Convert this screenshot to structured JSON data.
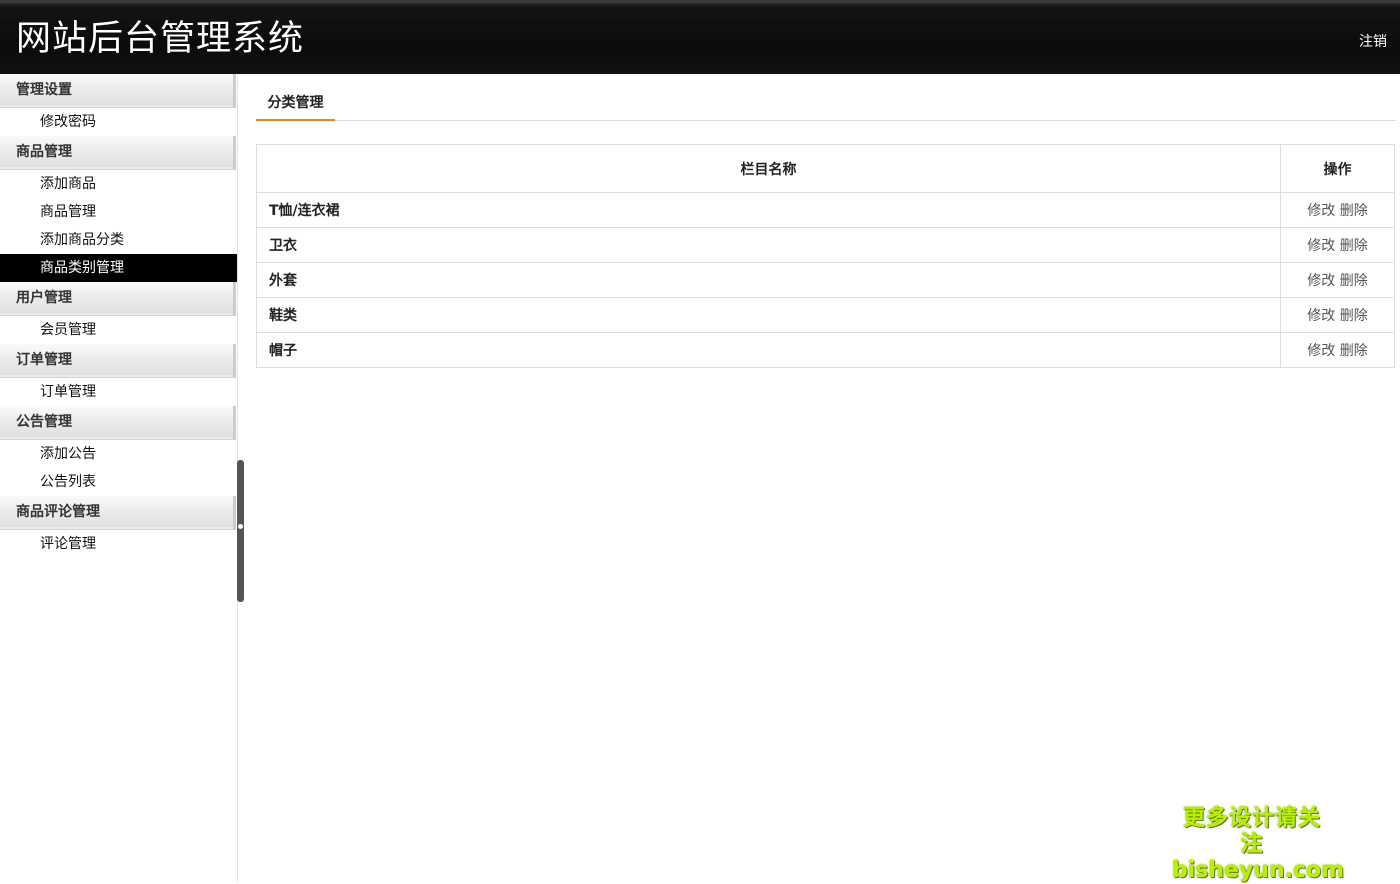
{
  "header": {
    "title": "网站后台管理系统",
    "logout": "注销"
  },
  "sidebar": {
    "groups": [
      {
        "label": "管理设置",
        "items": [
          "修改密码"
        ]
      },
      {
        "label": "商品管理",
        "items": [
          "添加商品",
          "商品管理",
          "添加商品分类",
          "商品类别管理"
        ]
      },
      {
        "label": "用户管理",
        "items": [
          "会员管理"
        ]
      },
      {
        "label": "订单管理",
        "items": [
          "订单管理"
        ]
      },
      {
        "label": "公告管理",
        "items": [
          "添加公告",
          "公告列表"
        ]
      },
      {
        "label": "商品评论管理",
        "items": [
          "评论管理"
        ]
      }
    ],
    "active_item": "商品类别管理"
  },
  "main": {
    "tab": "分类管理",
    "table": {
      "headers": [
        "栏目名称",
        "操作"
      ],
      "rows": [
        {
          "name": "T恤/连衣裙",
          "edit": "修改",
          "delete": "删除"
        },
        {
          "name": "卫衣",
          "edit": "修改",
          "delete": "删除"
        },
        {
          "name": "外套",
          "edit": "修改",
          "delete": "删除"
        },
        {
          "name": "鞋类",
          "edit": "修改",
          "delete": "删除"
        },
        {
          "name": "帽子",
          "edit": "修改",
          "delete": "删除"
        }
      ]
    }
  },
  "watermark": {
    "line1": "更多设计请关注",
    "line2": "bisheyun.com"
  },
  "colors": {
    "header_bg": "#0b0b0b",
    "active_item_bg": "#000000",
    "tab_underline": "#e58a1a",
    "watermark": "#b8f000"
  }
}
